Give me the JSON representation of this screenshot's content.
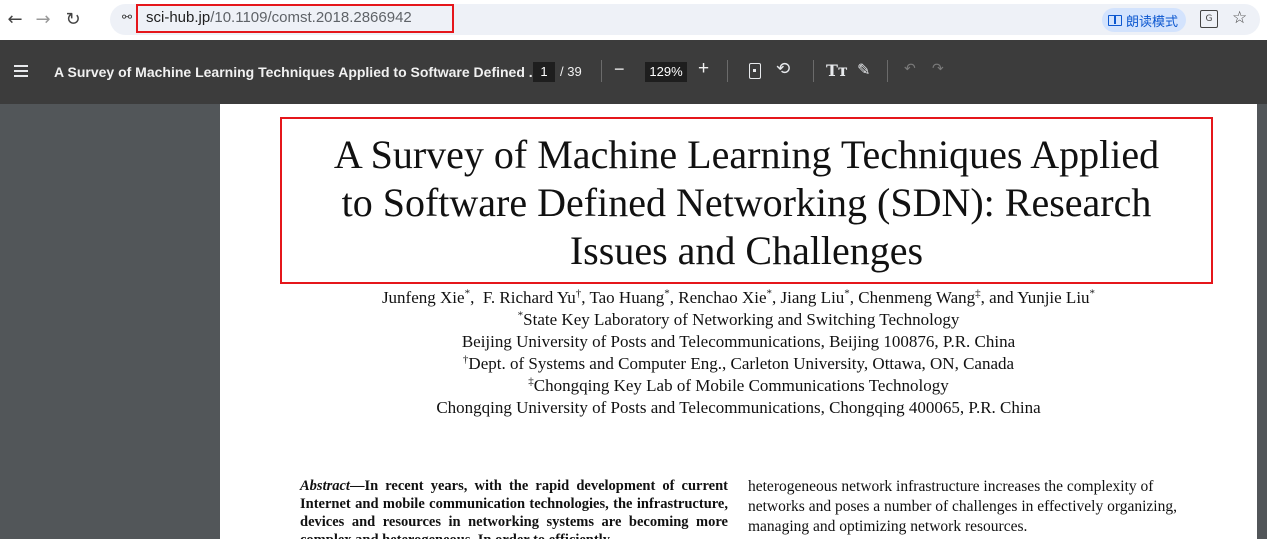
{
  "browser": {
    "url_host": "sci-hub.jp",
    "url_path": "/10.1109/comst.2018.2866942",
    "reader_mode_label": "朗读模式",
    "icons": [
      "back-arrow-icon",
      "forward-arrow-icon",
      "reload-icon",
      "site-settings-icon",
      "reader-mode-icon",
      "translate-icon",
      "bookmark-star-icon"
    ]
  },
  "pdf_toolbar": {
    "title": "A Survey of Machine Learning Techniques Applied to Software Defined ...",
    "page_current": "1",
    "page_total": "/ 39",
    "zoom_out": "−",
    "zoom_level": "129%",
    "zoom_in": "+",
    "icons": [
      "menu-icon",
      "fit-page-icon",
      "rotate-icon",
      "text-annotate-icon",
      "draw-icon",
      "undo-icon",
      "redo-icon"
    ]
  },
  "paper": {
    "title": "A Survey of Machine Learning Techniques Applied to Software Defined Networking (SDN): Research Issues and Challenges",
    "title_lines": [
      "A Survey of Machine Learning Techniques Applied",
      "to Software Defined Networking (SDN): Research",
      "Issues and Challenges"
    ],
    "authors": [
      {
        "name": "Junfeng Xie",
        "mark": "*"
      },
      {
        "name": "F. Richard Yu",
        "mark": "†"
      },
      {
        "name": "Tao Huang",
        "mark": "*"
      },
      {
        "name": "Renchao Xie",
        "mark": "*"
      },
      {
        "name": "Jiang Liu",
        "mark": "*"
      },
      {
        "name": "Chenmeng Wang",
        "mark": "‡"
      },
      {
        "name": "Yunjie Liu",
        "mark": "*"
      }
    ],
    "affiliations": [
      {
        "mark": "*",
        "line1": "State Key Laboratory of Networking and Switching Technology",
        "line2": "Beijing University of Posts and Telecommunications, Beijing 100876, P.R. China"
      },
      {
        "mark": "†",
        "line1": "Dept. of Systems and Computer Eng., Carleton University, Ottawa, ON, Canada",
        "line2": ""
      },
      {
        "mark": "‡",
        "line1": "Chongqing Key Lab of Mobile Communications Technology",
        "line2": "Chongqing University of Posts and Telecommunications, Chongqing 400065, P.R. China"
      }
    ],
    "abstract_label": "Abstract",
    "abstract_left": "—In recent years, with the rapid development of current Internet and mobile communication technologies, the infrastructure, devices and resources in networking systems are becoming more complex and heterogeneous. In order to efficiently",
    "abstract_right": "heterogeneous network infrastructure increases the complexity of networks and poses a number of challenges in effectively organizing, managing and optimizing network resources."
  },
  "colors": {
    "highlight_box": "#e5161b",
    "pdf_toolbar_bg": "#3c3c3c",
    "viewer_bg": "#525659",
    "reader_chip_bg": "#d3e3fd"
  }
}
